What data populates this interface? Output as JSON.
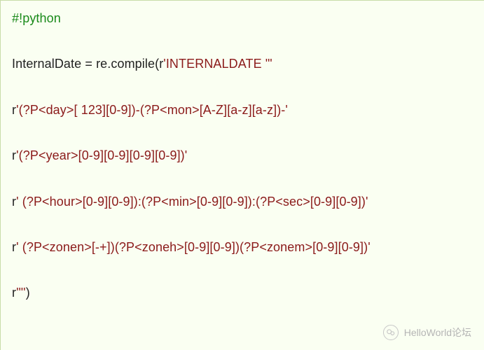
{
  "code": {
    "lines": [
      {
        "segments": [
          {
            "cls": "shebang",
            "text": "#!python"
          }
        ]
      },
      {
        "segments": [
          {
            "cls": "normal",
            "text": "InternalDate = re.compile(r"
          },
          {
            "cls": "string",
            "text": "'INTERNALDATE \"'"
          }
        ]
      },
      {
        "segments": [
          {
            "cls": "normal",
            "text": "r"
          },
          {
            "cls": "string",
            "text": "'(?P<day>[ 123][0-9])-(?P<mon>[A-Z][a-z][a-z])-'"
          }
        ]
      },
      {
        "segments": [
          {
            "cls": "normal",
            "text": "r"
          },
          {
            "cls": "string",
            "text": "'(?P<year>[0-9][0-9][0-9][0-9])'"
          }
        ]
      },
      {
        "segments": [
          {
            "cls": "normal",
            "text": "r"
          },
          {
            "cls": "string",
            "text": "' (?P<hour>[0-9][0-9]):(?P<min>[0-9][0-9]):(?P<sec>[0-9][0-9])'"
          }
        ]
      },
      {
        "segments": [
          {
            "cls": "normal",
            "text": "r"
          },
          {
            "cls": "string",
            "text": "' (?P<zonen>[-+])(?P<zoneh>[0-9][0-9])(?P<zonem>[0-9][0-9])'"
          }
        ]
      },
      {
        "segments": [
          {
            "cls": "normal",
            "text": "r"
          },
          {
            "cls": "string",
            "text": "'\"'"
          },
          {
            "cls": "normal",
            "text": ")"
          }
        ]
      }
    ]
  },
  "watermark": {
    "text": "HelloWorld论坛"
  }
}
